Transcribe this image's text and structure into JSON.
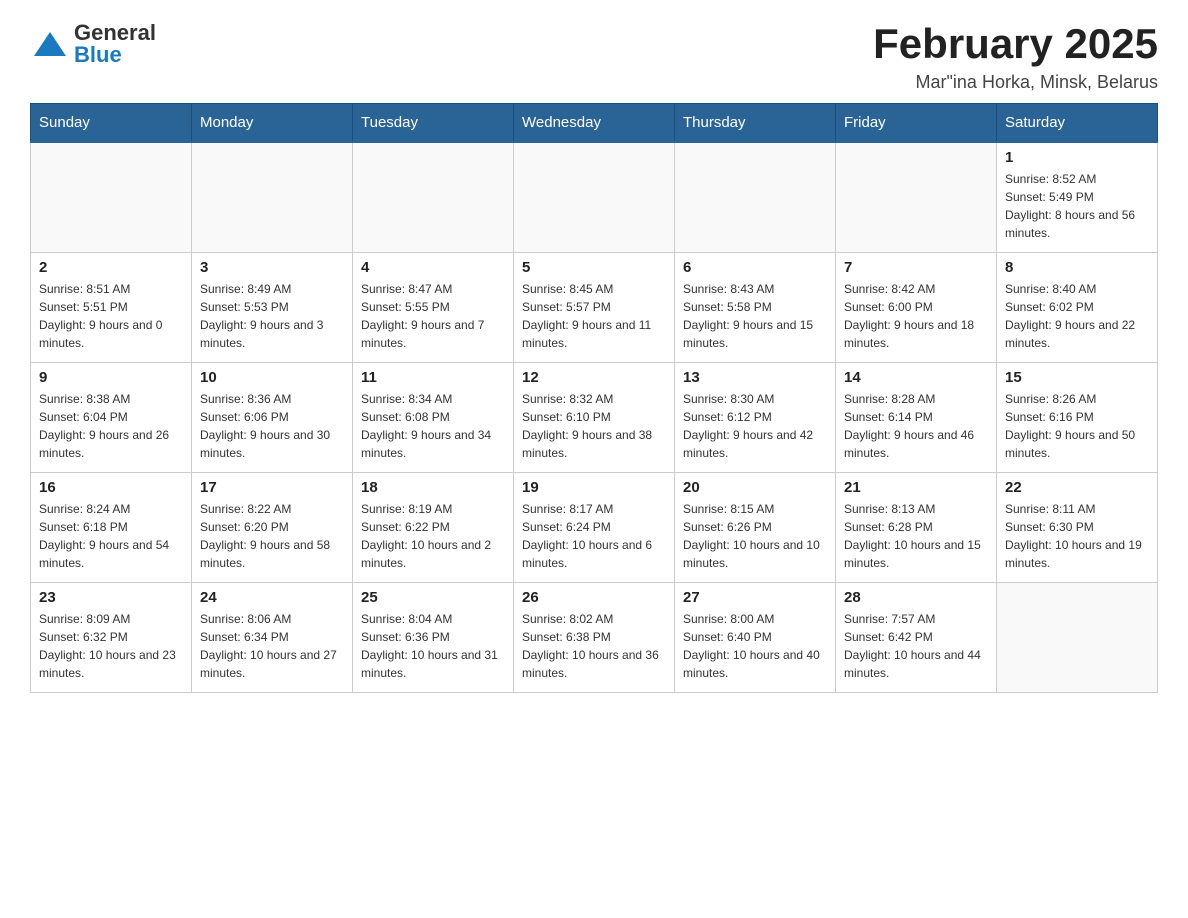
{
  "header": {
    "logo_general": "General",
    "logo_blue": "Blue",
    "title": "February 2025",
    "subtitle": "Mar\"ina Horka, Minsk, Belarus"
  },
  "calendar": {
    "days_of_week": [
      "Sunday",
      "Monday",
      "Tuesday",
      "Wednesday",
      "Thursday",
      "Friday",
      "Saturday"
    ],
    "weeks": [
      [
        {
          "day": "",
          "info": ""
        },
        {
          "day": "",
          "info": ""
        },
        {
          "day": "",
          "info": ""
        },
        {
          "day": "",
          "info": ""
        },
        {
          "day": "",
          "info": ""
        },
        {
          "day": "",
          "info": ""
        },
        {
          "day": "1",
          "info": "Sunrise: 8:52 AM\nSunset: 5:49 PM\nDaylight: 8 hours and 56 minutes."
        }
      ],
      [
        {
          "day": "2",
          "info": "Sunrise: 8:51 AM\nSunset: 5:51 PM\nDaylight: 9 hours and 0 minutes."
        },
        {
          "day": "3",
          "info": "Sunrise: 8:49 AM\nSunset: 5:53 PM\nDaylight: 9 hours and 3 minutes."
        },
        {
          "day": "4",
          "info": "Sunrise: 8:47 AM\nSunset: 5:55 PM\nDaylight: 9 hours and 7 minutes."
        },
        {
          "day": "5",
          "info": "Sunrise: 8:45 AM\nSunset: 5:57 PM\nDaylight: 9 hours and 11 minutes."
        },
        {
          "day": "6",
          "info": "Sunrise: 8:43 AM\nSunset: 5:58 PM\nDaylight: 9 hours and 15 minutes."
        },
        {
          "day": "7",
          "info": "Sunrise: 8:42 AM\nSunset: 6:00 PM\nDaylight: 9 hours and 18 minutes."
        },
        {
          "day": "8",
          "info": "Sunrise: 8:40 AM\nSunset: 6:02 PM\nDaylight: 9 hours and 22 minutes."
        }
      ],
      [
        {
          "day": "9",
          "info": "Sunrise: 8:38 AM\nSunset: 6:04 PM\nDaylight: 9 hours and 26 minutes."
        },
        {
          "day": "10",
          "info": "Sunrise: 8:36 AM\nSunset: 6:06 PM\nDaylight: 9 hours and 30 minutes."
        },
        {
          "day": "11",
          "info": "Sunrise: 8:34 AM\nSunset: 6:08 PM\nDaylight: 9 hours and 34 minutes."
        },
        {
          "day": "12",
          "info": "Sunrise: 8:32 AM\nSunset: 6:10 PM\nDaylight: 9 hours and 38 minutes."
        },
        {
          "day": "13",
          "info": "Sunrise: 8:30 AM\nSunset: 6:12 PM\nDaylight: 9 hours and 42 minutes."
        },
        {
          "day": "14",
          "info": "Sunrise: 8:28 AM\nSunset: 6:14 PM\nDaylight: 9 hours and 46 minutes."
        },
        {
          "day": "15",
          "info": "Sunrise: 8:26 AM\nSunset: 6:16 PM\nDaylight: 9 hours and 50 minutes."
        }
      ],
      [
        {
          "day": "16",
          "info": "Sunrise: 8:24 AM\nSunset: 6:18 PM\nDaylight: 9 hours and 54 minutes."
        },
        {
          "day": "17",
          "info": "Sunrise: 8:22 AM\nSunset: 6:20 PM\nDaylight: 9 hours and 58 minutes."
        },
        {
          "day": "18",
          "info": "Sunrise: 8:19 AM\nSunset: 6:22 PM\nDaylight: 10 hours and 2 minutes."
        },
        {
          "day": "19",
          "info": "Sunrise: 8:17 AM\nSunset: 6:24 PM\nDaylight: 10 hours and 6 minutes."
        },
        {
          "day": "20",
          "info": "Sunrise: 8:15 AM\nSunset: 6:26 PM\nDaylight: 10 hours and 10 minutes."
        },
        {
          "day": "21",
          "info": "Sunrise: 8:13 AM\nSunset: 6:28 PM\nDaylight: 10 hours and 15 minutes."
        },
        {
          "day": "22",
          "info": "Sunrise: 8:11 AM\nSunset: 6:30 PM\nDaylight: 10 hours and 19 minutes."
        }
      ],
      [
        {
          "day": "23",
          "info": "Sunrise: 8:09 AM\nSunset: 6:32 PM\nDaylight: 10 hours and 23 minutes."
        },
        {
          "day": "24",
          "info": "Sunrise: 8:06 AM\nSunset: 6:34 PM\nDaylight: 10 hours and 27 minutes."
        },
        {
          "day": "25",
          "info": "Sunrise: 8:04 AM\nSunset: 6:36 PM\nDaylight: 10 hours and 31 minutes."
        },
        {
          "day": "26",
          "info": "Sunrise: 8:02 AM\nSunset: 6:38 PM\nDaylight: 10 hours and 36 minutes."
        },
        {
          "day": "27",
          "info": "Sunrise: 8:00 AM\nSunset: 6:40 PM\nDaylight: 10 hours and 40 minutes."
        },
        {
          "day": "28",
          "info": "Sunrise: 7:57 AM\nSunset: 6:42 PM\nDaylight: 10 hours and 44 minutes."
        },
        {
          "day": "",
          "info": ""
        }
      ]
    ]
  }
}
